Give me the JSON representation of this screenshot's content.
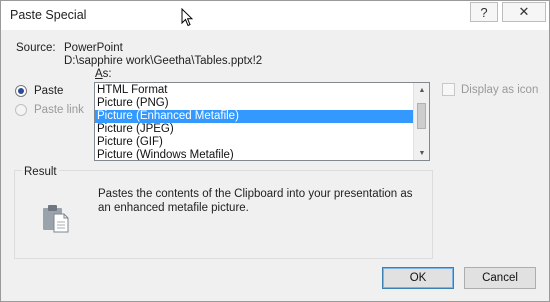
{
  "window": {
    "title": "Paste Special",
    "help_button": "?",
    "close_button": "✕"
  },
  "source": {
    "label": "Source:",
    "app": "PowerPoint",
    "path": "D:\\sapphire work\\Geetha\\Tables.pptx!2"
  },
  "as_label_prefix": "A",
  "as_label_rest": "s:",
  "options": {
    "paste_label": "Paste",
    "paste_link_label": "Paste link",
    "selected": "Paste"
  },
  "formats": {
    "items": [
      "HTML Format",
      "Picture (PNG)",
      "Picture (Enhanced Metafile)",
      "Picture (JPEG)",
      "Picture (GIF)",
      "Picture (Windows Metafile)"
    ],
    "selected": "Picture (Enhanced Metafile)"
  },
  "display_as_icon": {
    "label": "Display as icon",
    "checked": false
  },
  "result": {
    "title": "Result",
    "text": "Pastes the contents of the Clipboard into your presentation as an enhanced metafile picture."
  },
  "buttons": {
    "ok": "OK",
    "cancel": "Cancel"
  },
  "colors": {
    "selection": "#3399ff",
    "dialog_bg": "#f0f0f0"
  }
}
